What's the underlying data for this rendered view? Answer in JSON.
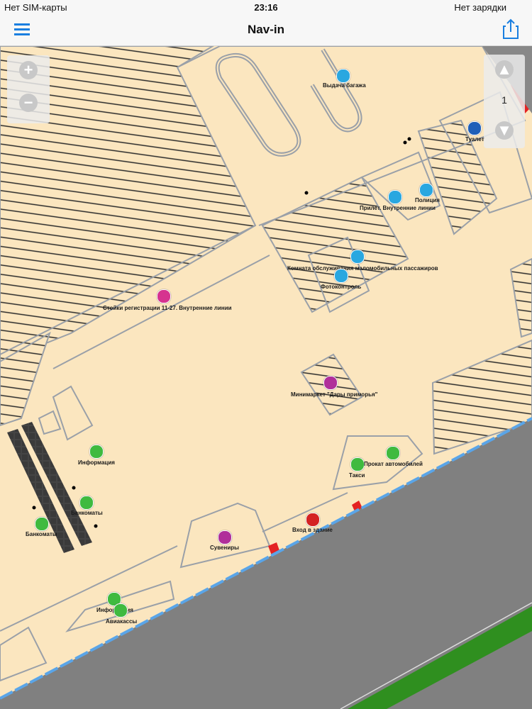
{
  "status_bar": {
    "carrier": "Нет SIM-карты",
    "time": "23:16",
    "battery": "Нет зарядки"
  },
  "nav_bar": {
    "title": "Nav-in",
    "menu_icon": "hamburger-menu-icon",
    "share_icon": "share-icon"
  },
  "map_controls": {
    "zoom_in_icon": "zoom-in-icon",
    "zoom_out_icon": "zoom-out-icon",
    "floor_up_icon": "floor-up-icon",
    "floor_down_icon": "floor-down-icon",
    "floor_number": "1"
  },
  "pois": [
    {
      "label": "Выдача багажа",
      "icon": "baggage-icon",
      "color": "#29a7e0"
    },
    {
      "label": "Туалет",
      "icon": "toilet-icon",
      "color": "#1f5fb8"
    },
    {
      "label": "Полиция",
      "icon": "police-icon",
      "color": "#29a7e0"
    },
    {
      "label": "Прилет. Внутренние линии",
      "icon": "arrival-icon",
      "color": "#29a7e0"
    },
    {
      "label": "Комната обслуживания маломобильных пассажиров",
      "icon": "accessibility-icon",
      "color": "#29a7e0"
    },
    {
      "label": "Фотоконтроль",
      "icon": "photo-control-icon",
      "color": "#29a7e0"
    },
    {
      "label": "Стойки регистрации 11-27. Внутренние линии",
      "icon": "check-in-icon",
      "color": "#d6338f"
    },
    {
      "label": "Минимаркет \"Дары приморья\"",
      "icon": "shop-icon",
      "color": "#b02f9a"
    },
    {
      "label": "Информация",
      "icon": "info-icon",
      "color": "#3fba3f"
    },
    {
      "label": "Банкоматы",
      "icon": "atm-icon",
      "color": "#3fba3f"
    },
    {
      "label": "Банкоматы",
      "icon": "atm-icon",
      "color": "#3fba3f"
    },
    {
      "label": "Такси",
      "icon": "taxi-icon",
      "color": "#3fba3f"
    },
    {
      "label": "Прокат автомобилей",
      "icon": "car-rental-icon",
      "color": "#3fba3f"
    },
    {
      "label": "Вход в здание",
      "icon": "entrance-icon",
      "color": "#d42222"
    },
    {
      "label": "Сувениры",
      "icon": "souvenir-icon",
      "color": "#b02f9a"
    },
    {
      "label": "Информация",
      "icon": "info-icon",
      "color": "#3fba3f"
    },
    {
      "label": "Авиакассы",
      "icon": "ticket-office-icon",
      "color": "#3fba3f"
    }
  ],
  "colors": {
    "floor": "#fbe6bf",
    "wall": "#9aa0a8",
    "road": "#808080",
    "grass": "#2f8f1f",
    "hatch": "#2a2a2a",
    "accent": "#1a7fe0"
  }
}
